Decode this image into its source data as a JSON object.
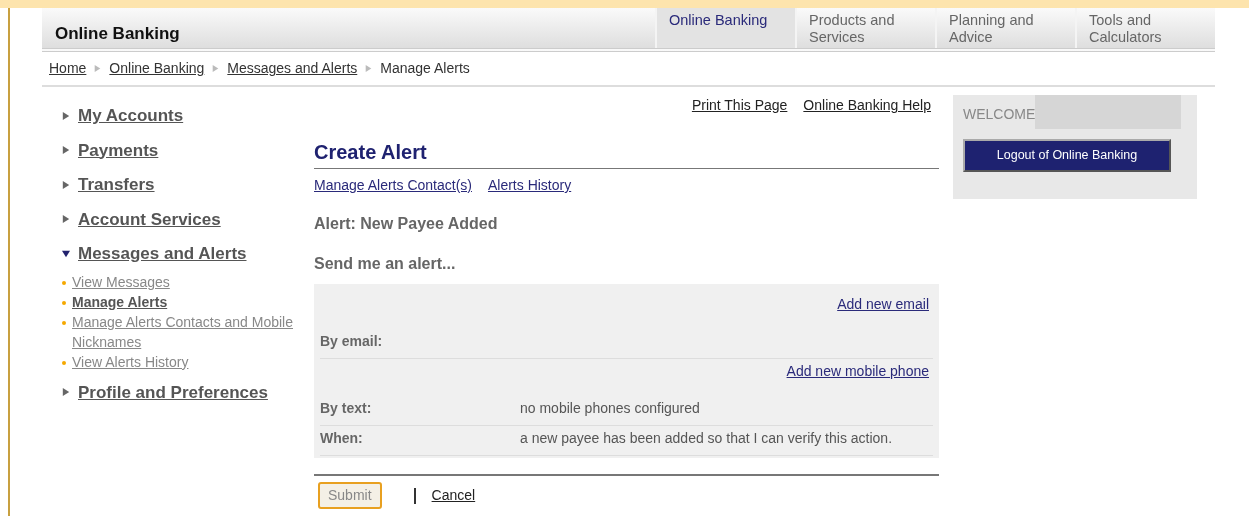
{
  "header": {
    "brand": "Online Banking",
    "tabs": [
      {
        "label": "Online Banking",
        "selected": true
      },
      {
        "label": "Products and Services",
        "selected": false
      },
      {
        "label": "Planning and Advice",
        "selected": false
      },
      {
        "label": "Tools and Calculators",
        "selected": false
      }
    ]
  },
  "breadcrumb": {
    "links": [
      "Home",
      "Online Banking",
      "Messages and Alerts"
    ],
    "current": "Manage Alerts"
  },
  "sidebar": {
    "items": [
      {
        "label": "My Accounts",
        "expanded": false
      },
      {
        "label": "Payments",
        "expanded": false
      },
      {
        "label": "Transfers",
        "expanded": false
      },
      {
        "label": "Account Services",
        "expanded": false
      },
      {
        "label": "Messages and Alerts",
        "expanded": true,
        "children": [
          {
            "label": "View Messages",
            "selected": false
          },
          {
            "label": "Manage Alerts",
            "selected": true
          },
          {
            "label": "Manage Alerts Contacts and Mobile Nicknames",
            "selected": false
          },
          {
            "label": "View Alerts History",
            "selected": false
          }
        ]
      },
      {
        "label": "Profile and Preferences",
        "expanded": false
      }
    ]
  },
  "utility_links": [
    "Print This Page",
    "Online Banking Help"
  ],
  "page_title": "Create Alert",
  "sub_links": [
    "Manage Alerts Contact(s)",
    "Alerts History"
  ],
  "alert_name": "Alert: New Payee Added",
  "intro": "Send me an alert...",
  "form_rows": [
    {
      "link": "Add new email",
      "label": "By email:"
    },
    {
      "link": "Add new mobile phone",
      "label": "By text:",
      "value": "no mobile phones configured"
    },
    {
      "label": "When:",
      "value": "a new payee has been added so that I can verify this action."
    }
  ],
  "actions": {
    "submit": "Submit",
    "cancel": "Cancel"
  },
  "welcome": {
    "label": "WELCOME",
    "logout": "Logout of Online Banking"
  }
}
